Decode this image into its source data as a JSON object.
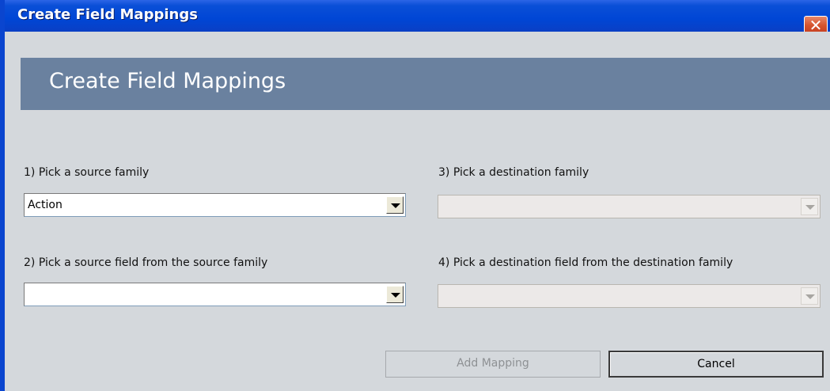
{
  "window": {
    "title": "Create Field Mappings",
    "close_glyph": "✕"
  },
  "header": {
    "title": "Create Field Mappings"
  },
  "form": {
    "source_family_label": "1) Pick a source family",
    "source_family_value": "Action",
    "source_field_label": "2) Pick a source field from the source family",
    "source_field_value": "",
    "destination_family_label": "3) Pick a destination family",
    "destination_family_value": "",
    "destination_field_label": "4) Pick a destination field from the destination family",
    "destination_field_value": ""
  },
  "buttons": {
    "add_mapping": "Add Mapping",
    "cancel": "Cancel"
  }
}
